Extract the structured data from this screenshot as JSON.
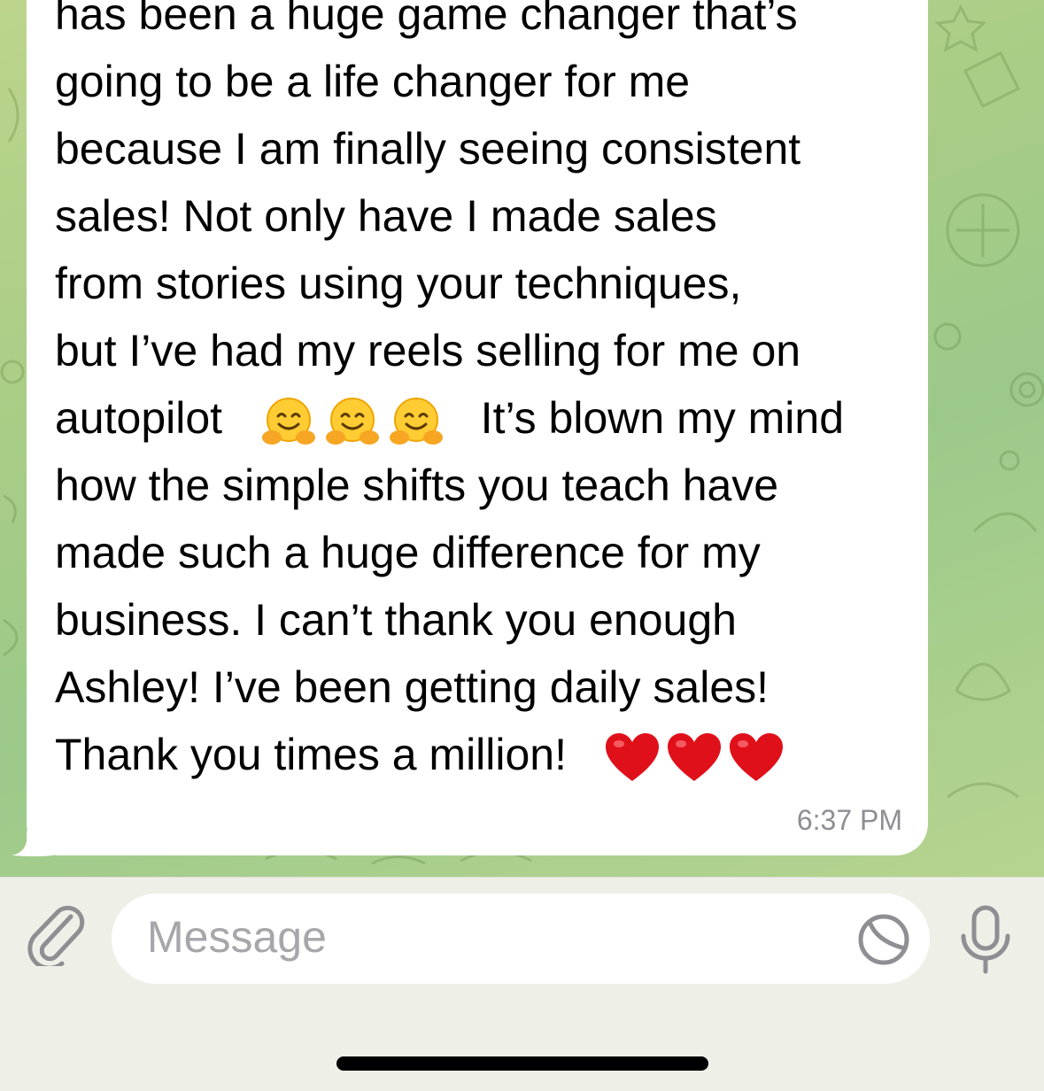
{
  "message": {
    "lines": [
      "has been a huge game changer that’s",
      "going to be a life changer for me",
      "because I am finally seeing consistent",
      "sales! Not only have I made sales",
      "from stories using your techniques,",
      "but I’ve had my reels selling for me on",
      "autopilot",
      "It’s blown my mind",
      "how the simple shifts you teach have",
      "made such a huge difference for my",
      "business. I can’t thank you enough",
      "Ashley! I’ve been getting daily sales!",
      "Thank you times a million!"
    ],
    "time": "6:37 PM"
  },
  "composer": {
    "placeholder": "Message"
  },
  "colors": {
    "bubble": "#ffffff",
    "chat_bg": "#a9cd86",
    "timestamp": "#8e8e93",
    "placeholder": "#a7a7ab",
    "icon": "#8e8e93"
  },
  "icons": {
    "attach": "paperclip-icon",
    "sticker": "sticker-icon",
    "mic": "microphone-icon",
    "hug": "hugging-face-emoji",
    "heart": "red-heart-emoji"
  }
}
